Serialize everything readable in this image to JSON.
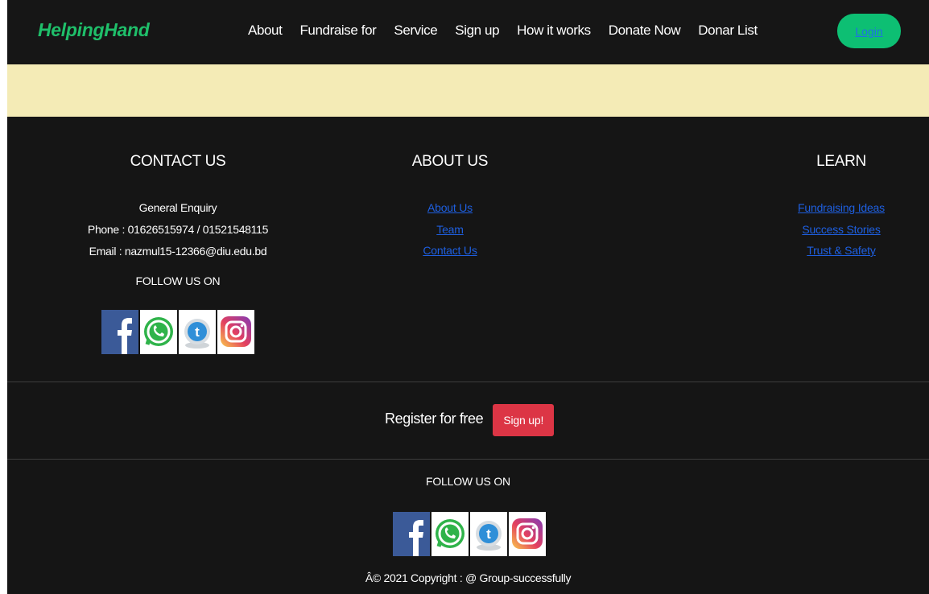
{
  "navbar": {
    "brand": "HelpingHand",
    "links": [
      "About",
      "Fundraise for",
      "Service",
      "Sign up",
      "How it works",
      "Donate Now",
      "Donar List"
    ],
    "login": "Login"
  },
  "colors": {
    "brand": "#1fbf6a",
    "login_bg": "#0dbf73",
    "banner_bg": "#f4ebb6",
    "footer_bg": "#151515",
    "link": "#1e5fe0",
    "signup_bg": "#dc3545"
  },
  "contact": {
    "heading": "CONTACT US",
    "enquiry": "General Enquiry",
    "phone": "Phone : 01626515974 / 01521548115",
    "email": "Email : nazmul15-12366@diu.edu.bd",
    "follow": "FOLLOW US ON"
  },
  "about": {
    "heading": "ABOUT US",
    "links": [
      "About Us",
      "Team",
      "Contact Us"
    ]
  },
  "learn": {
    "heading": "LEARN",
    "links": [
      "Fundraising Ideas",
      "Success Stories",
      "Trust & Safety"
    ]
  },
  "social_icons": [
    "facebook-icon",
    "whatsapp-icon",
    "twitter-icon",
    "instagram-icon"
  ],
  "register": {
    "text": "Register for free",
    "button": "Sign up!"
  },
  "bottom": {
    "follow": "FOLLOW US ON",
    "copyright": "Â© 2021 Copyright : @ Group-successfully"
  }
}
